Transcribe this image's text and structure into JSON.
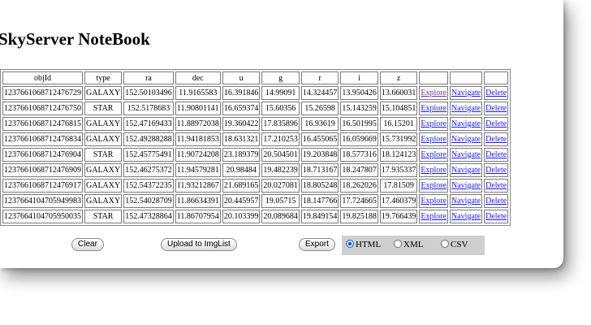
{
  "page": {
    "title": "SkyServer NoteBook"
  },
  "table": {
    "columns": [
      "objId",
      "type",
      "ra",
      "dec",
      "u",
      "g",
      "r",
      "i",
      "z",
      "",
      "",
      ""
    ],
    "action_labels": {
      "explore": "Explore",
      "navigate": "Navigate",
      "delete": "Delete"
    },
    "rows": [
      [
        "1237661068712476729",
        "GALAXY",
        "152.50103496",
        "11.9165583",
        "16.391846",
        "14.99091",
        "14.324457",
        "13.950426",
        "13.660031"
      ],
      [
        "1237661068712476750",
        "STAR",
        "152.5178683",
        "11.90801141",
        "16.659374",
        "15.60356",
        "15.26598",
        "15.143259",
        "15.104851"
      ],
      [
        "1237661068712476815",
        "GALAXY",
        "152.47169433",
        "11.88972038",
        "19.360422",
        "17.835896",
        "16.93619",
        "16.501995",
        "16.15201"
      ],
      [
        "1237661068712476834",
        "GALAXY",
        "152.49288288",
        "11.94181853",
        "18.631321",
        "17.210253",
        "16.455065",
        "16.059669",
        "15.731992"
      ],
      [
        "1237661068712476904",
        "STAR",
        "152.45775491",
        "11.90724208",
        "23.189379",
        "20.504501",
        "19.203848",
        "18.577316",
        "18.124123"
      ],
      [
        "1237661068712476909",
        "GALAXY",
        "152.46275372",
        "11.94579281",
        "20.98484",
        "19.482239",
        "18.713167",
        "18.247807",
        "17.935337"
      ],
      [
        "1237661068712476917",
        "GALAXY",
        "152.54372235",
        "11.93212867",
        "21.689165",
        "20.027081",
        "18.805248",
        "18.262026",
        "17.81509"
      ],
      [
        "1237664104705949983",
        "GALAXY",
        "152.54028709",
        "11.86634391",
        "20.445957",
        "19.05715",
        "18.147766",
        "17.724665",
        "17.460379"
      ],
      [
        "1237664104705950035",
        "STAR",
        "152.47328864",
        "11.86707954",
        "20.103399",
        "20.089684",
        "19.849154",
        "19.825188",
        "19.766439"
      ]
    ]
  },
  "controls": {
    "clear_label": "Clear",
    "upload_label": "Upload to ImgList",
    "export_label": "Export",
    "format_options": [
      "HTML",
      "XML",
      "CSV"
    ],
    "selected_format": "HTML"
  },
  "colors": {
    "link": "#1a1aee",
    "visited_link": "#7b2fa8",
    "panel": "#cfcfcf"
  }
}
